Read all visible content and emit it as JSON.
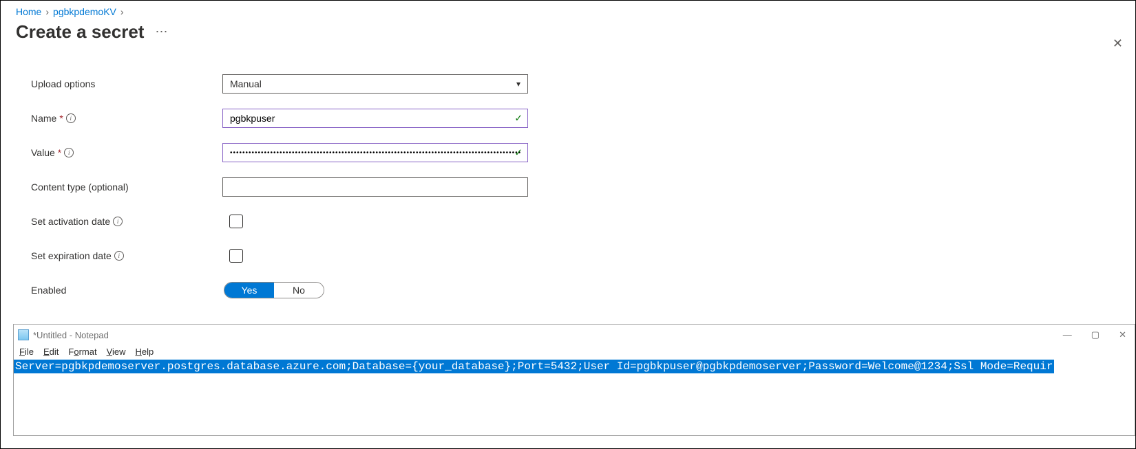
{
  "breadcrumb": {
    "home": "Home",
    "kv": "pgbkpdemoKV"
  },
  "page": {
    "title": "Create a secret"
  },
  "form": {
    "upload_options_label": "Upload options",
    "upload_options_value": "Manual",
    "name_label": "Name",
    "name_value": "pgbkpuser",
    "value_label": "Value",
    "value_value": "••••••••••••••••••••••••••••••••••••••••••••••••••••••••••••••••••••••••••••••••••••••••••••••••••",
    "content_type_label": "Content type (optional)",
    "content_type_value": "",
    "activation_label": "Set activation date",
    "expiration_label": "Set expiration date",
    "enabled_label": "Enabled",
    "enabled_yes": "Yes",
    "enabled_no": "No"
  },
  "notepad": {
    "title": "*Untitled - Notepad",
    "menu": {
      "file": "File",
      "edit": "Edit",
      "format": "Format",
      "view": "View",
      "help": "Help"
    },
    "content": "Server=pgbkpdemoserver.postgres.database.azure.com;Database={your_database};Port=5432;User Id=pgbkpuser@pgbkpdemoserver;Password=Welcome@1234;Ssl Mode=Requir"
  }
}
